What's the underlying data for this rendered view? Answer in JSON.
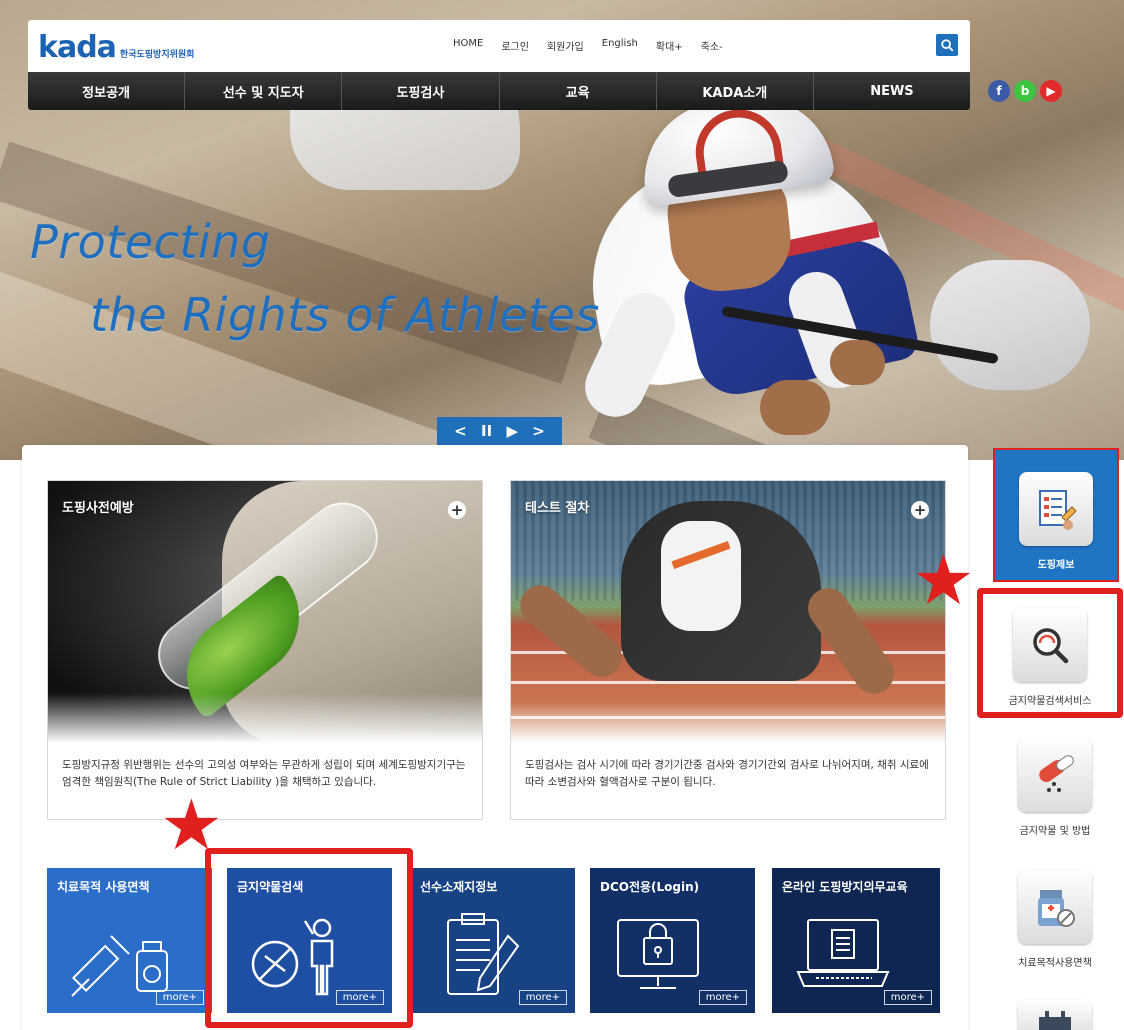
{
  "header": {
    "logo_word": "kada",
    "logo_sub": "한국도핑방지위원회",
    "util_links": [
      "HOME",
      "로그인",
      "회원가입",
      "English",
      "확대+",
      "축소-"
    ]
  },
  "nav": {
    "items": [
      "정보공개",
      "선수 및 지도자",
      "도핑검사",
      "교육",
      "KADA소개",
      "NEWS"
    ]
  },
  "social": {
    "fb": "f",
    "blog": "b",
    "youtube": "▶"
  },
  "hero": {
    "line1": "Protecting",
    "line2": "the Rights of Athletes",
    "controls": {
      "prev": "<",
      "pause": "II",
      "play": "▶",
      "next": ">"
    }
  },
  "cards": [
    {
      "title": "도핑사전예방",
      "desc": "도핑방지규정 위반행위는 선수의 고의성 여부와는 무관하게 성립이 되며 세계도핑방지기구는 엄격한 책임원칙(The Rule of Strict Liability )을 채택하고 있습니다."
    },
    {
      "title": "테스트 절차",
      "desc": "도핑검사는 검사 시기에 따라 경기기간중 검사와 경기기간외 검사로 나뉘어지며, 채취 시료에 따라 소변검사와 혈액검사로 구분이 됩니다."
    }
  ],
  "tiles": [
    {
      "title": "치료목적 사용면책",
      "more": "more+"
    },
    {
      "title": "금지약물검색",
      "more": "more+"
    },
    {
      "title": "선수소재지정보",
      "more": "more+"
    },
    {
      "title": "DCO전용(Login)",
      "more": "more+"
    },
    {
      "title": "온라인 도핑방지의무교육",
      "more": "more+"
    }
  ],
  "side_menu": [
    {
      "label": "도핑제보"
    },
    {
      "label": "금지약물검색서비스"
    },
    {
      "label": "금지약물 및 방법"
    },
    {
      "label": "치료목적사용면책"
    }
  ],
  "colors": {
    "accent": "#1f6fba",
    "highlight": "#e01f1f",
    "nav_bg": "#222222"
  }
}
